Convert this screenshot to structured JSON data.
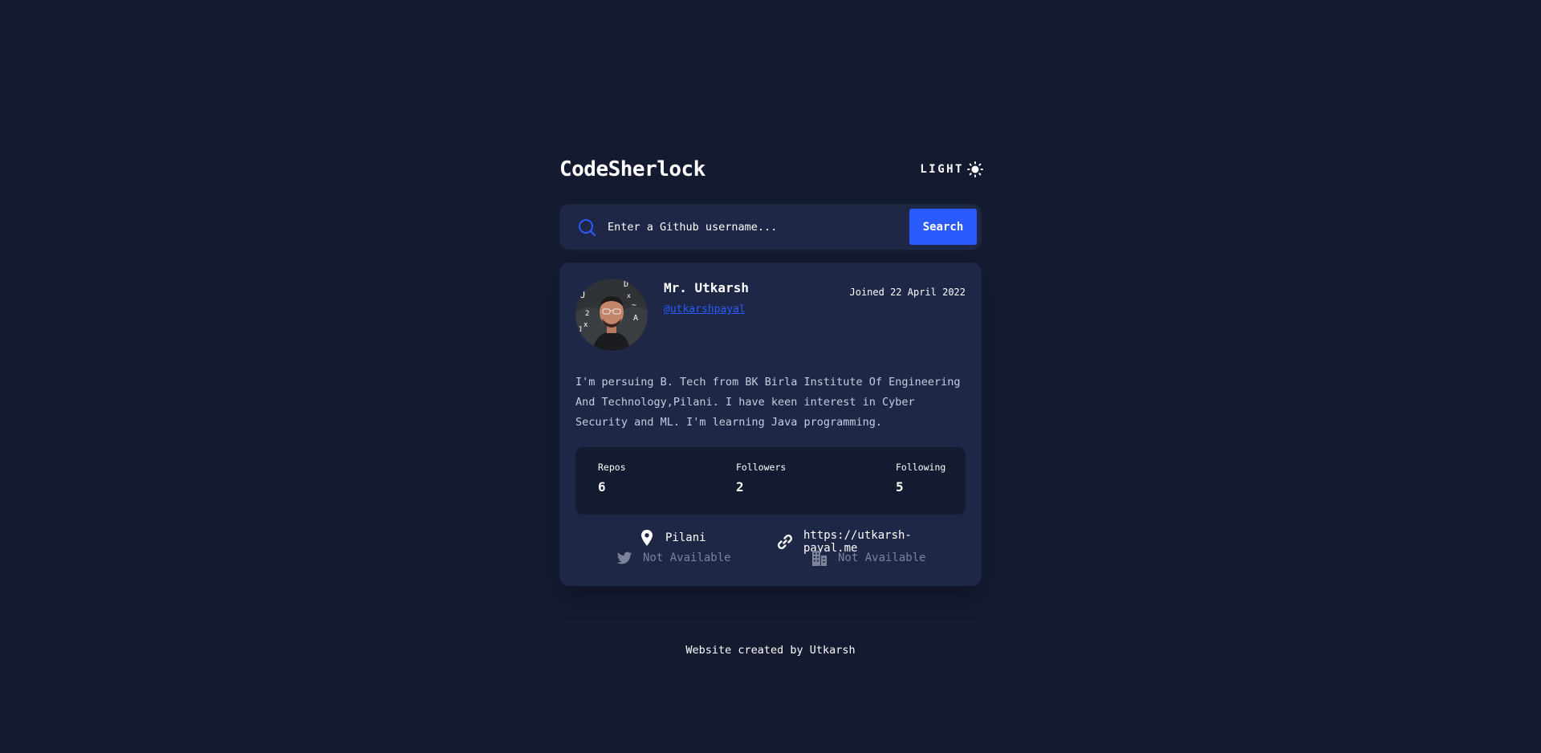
{
  "app": {
    "title": "CodeSherlock"
  },
  "theme_toggle": {
    "label": "LIGHT",
    "icon": "sun-icon"
  },
  "search": {
    "icon": "search-icon",
    "placeholder": "Enter a Github username...",
    "value": "",
    "button_label": "Search"
  },
  "profile": {
    "name": "Mr. Utkarsh",
    "username": "@utkarshpayal",
    "joined": "Joined 22 April 2022",
    "avatar": "avatar-image",
    "bio": "I'm persuing B. Tech from BK Birla Institute Of Engineering And Technology,Pilani. I have keen interest in Cyber Security and ML. I'm learning Java programming.",
    "stats": {
      "repos": {
        "label": "Repos",
        "value": "6"
      },
      "followers": {
        "label": "Followers",
        "value": "2"
      },
      "following": {
        "label": "Following",
        "value": "5"
      }
    },
    "links": {
      "location": {
        "icon": "location-pin-icon",
        "text": "Pilani"
      },
      "website": {
        "icon": "link-icon",
        "text": "https://utkarsh-payal.me"
      },
      "twitter": {
        "icon": "twitter-icon",
        "text": "Not Available"
      },
      "company": {
        "icon": "building-icon",
        "text": "Not Available"
      }
    }
  },
  "footer": {
    "text": "Website created by Utkarsh"
  },
  "colors": {
    "background": "#141a2f",
    "card": "#1e2746",
    "accent": "#2a5bff",
    "muted": "#7b829a"
  }
}
